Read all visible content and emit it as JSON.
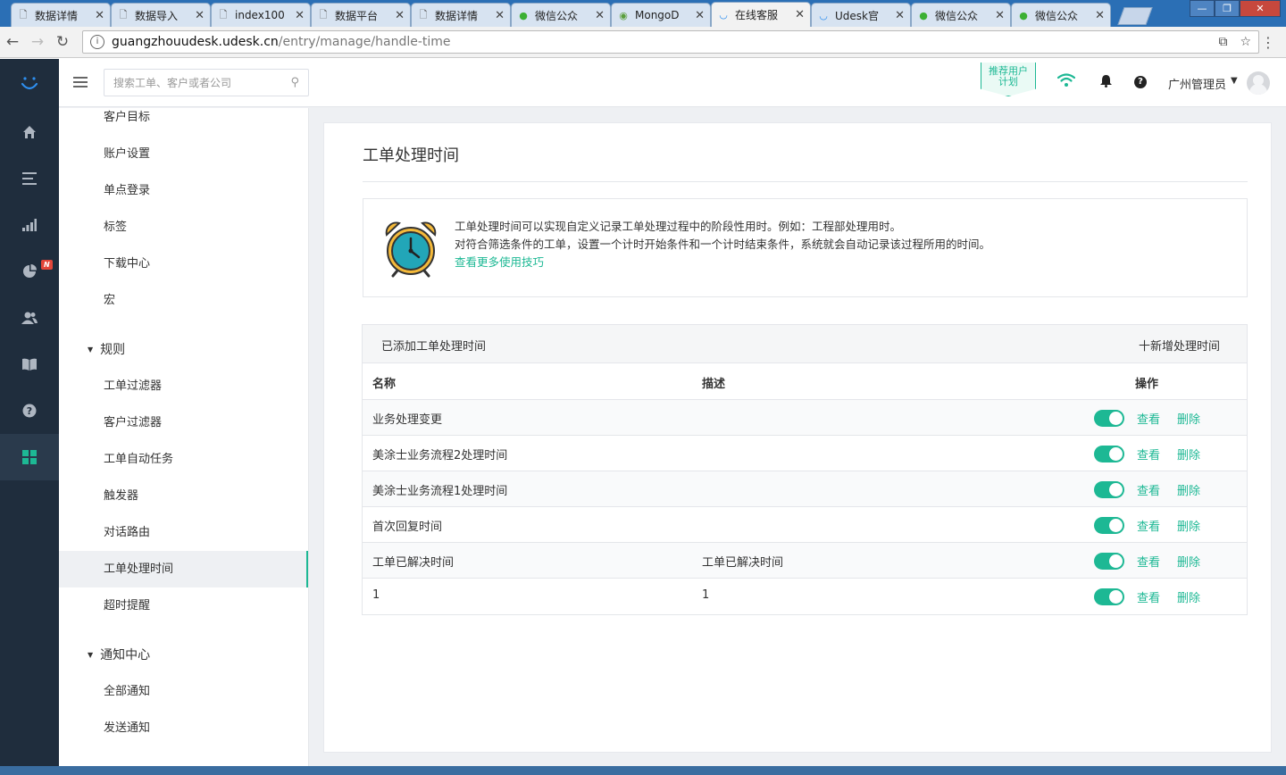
{
  "browser": {
    "tabs": [
      {
        "label": "数据详情",
        "icon": "page-icon"
      },
      {
        "label": "数据导入",
        "icon": "page-icon"
      },
      {
        "label": "index100",
        "icon": "page-icon"
      },
      {
        "label": "数据平台",
        "icon": "page-icon"
      },
      {
        "label": "数据详情",
        "icon": "page-icon"
      },
      {
        "label": "微信公众",
        "icon": "wechat-icon"
      },
      {
        "label": "MongoD",
        "icon": "mongo-icon"
      },
      {
        "label": "在线客服",
        "icon": "udesk-icon",
        "active": true
      },
      {
        "label": "Udesk官",
        "icon": "udesk-icon"
      },
      {
        "label": "微信公众",
        "icon": "wechat-icon"
      },
      {
        "label": "微信公众",
        "icon": "wechat-icon"
      }
    ],
    "url_host": "guangzhouudesk.udesk.cn",
    "url_path": "/entry/manage/handle-time"
  },
  "app": {
    "search_placeholder": "搜索工单、客户或者公司",
    "promo": {
      "line1": "推荐用户",
      "line2": "计划"
    },
    "user_name": "广州管理员",
    "rail_badge": "N",
    "accent_color": "#1db894",
    "rail_color": "#1f2d3d"
  },
  "submenu": {
    "items": [
      {
        "label": "客户目标"
      },
      {
        "label": "账户设置"
      },
      {
        "label": "单点登录"
      },
      {
        "label": "标签"
      },
      {
        "label": "下载中心"
      },
      {
        "label": "宏"
      }
    ],
    "group_rules": "规则",
    "rules_items": [
      {
        "label": "工单过滤器"
      },
      {
        "label": "客户过滤器"
      },
      {
        "label": "工单自动任务"
      },
      {
        "label": "触发器"
      },
      {
        "label": "对话路由"
      },
      {
        "label": "工单处理时间",
        "active": true
      },
      {
        "label": "超时提醒"
      }
    ],
    "group_notify": "通知中心",
    "notify_items": [
      {
        "label": "全部通知"
      },
      {
        "label": "发送通知"
      }
    ]
  },
  "page": {
    "title": "工单处理时间",
    "info_line1": "工单处理时间可以实现自定义记录工单处理过程中的阶段性用时。例如：工程部处理用时。",
    "info_line2": "对符合筛选条件的工单，设置一个计时开始条件和一个计时结束条件，系统就会自动记录该过程所用的时间。",
    "info_link": "查看更多使用技巧",
    "table_caption": "已添加工单处理时间",
    "add_button": "十新增处理时间",
    "columns": {
      "name": "名称",
      "desc": "描述",
      "ops": "操作"
    },
    "rows": [
      {
        "name": "业务处理变更",
        "desc": "",
        "enabled": true,
        "view": "查看",
        "delete": "删除"
      },
      {
        "name": "美涂士业务流程2处理时间",
        "desc": "",
        "enabled": true,
        "view": "查看",
        "delete": "删除"
      },
      {
        "name": "美涂士业务流程1处理时间",
        "desc": "",
        "enabled": true,
        "view": "查看",
        "delete": "删除"
      },
      {
        "name": "首次回复时间",
        "desc": "",
        "enabled": true,
        "view": "查看",
        "delete": "删除"
      },
      {
        "name": "工单已解决时间",
        "desc": "工单已解决时间",
        "enabled": true,
        "view": "查看",
        "delete": "删除"
      },
      {
        "name": "1",
        "desc": "1",
        "enabled": true,
        "view": "查看",
        "delete": "删除"
      }
    ]
  }
}
